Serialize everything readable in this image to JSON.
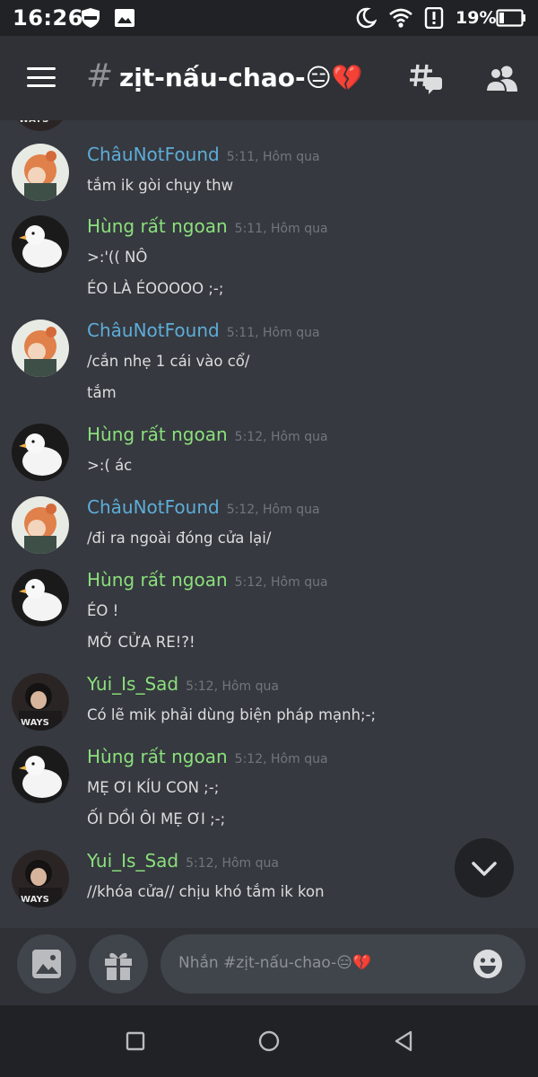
{
  "status_bar": {
    "time": "16:26",
    "battery_percent": "19%",
    "icons": [
      "shield-icon",
      "image-icon",
      "moon-icon",
      "wifi-icon",
      "alert-icon",
      "battery-icon"
    ]
  },
  "header": {
    "hash": "#",
    "channel_name": "zịt-nấu-chao-😑💔",
    "icons": [
      "menu-icon",
      "threads-icon",
      "members-icon"
    ]
  },
  "messages": [
    {
      "author": "ChâuNotFound",
      "time": "5:11, Hôm qua",
      "color": "#5dadd9",
      "avatar": "chau",
      "lines": [
        "tắm ik gòi chụy thw"
      ]
    },
    {
      "author": "Hùng rất ngoan",
      "time": "5:11, Hôm qua",
      "color": "#8be07c",
      "avatar": "duck",
      "lines": [
        ">:'(( NÔ",
        "ÉO LÀ ÉOOOOO ;-;"
      ]
    },
    {
      "author": "ChâuNotFound",
      "time": "5:11, Hôm qua",
      "color": "#5dadd9",
      "avatar": "chau",
      "lines": [
        "/cắn nhẹ 1 cái vào cổ/",
        "tắm"
      ]
    },
    {
      "author": "Hùng rất ngoan",
      "time": "5:12, Hôm qua",
      "color": "#8be07c",
      "avatar": "duck",
      "lines": [
        ">:( ác"
      ]
    },
    {
      "author": "ChâuNotFound",
      "time": "5:12, Hôm qua",
      "color": "#5dadd9",
      "avatar": "chau",
      "lines": [
        "/đi ra ngoài đóng cửa lại/"
      ]
    },
    {
      "author": "Hùng rất ngoan",
      "time": "5:12, Hôm qua",
      "color": "#8be07c",
      "avatar": "duck",
      "lines": [
        "ÉO !",
        "MỞ CỬA RE!?!"
      ]
    },
    {
      "author": "Yui_Is_Sad",
      "time": "5:12, Hôm qua",
      "color": "#8be07c",
      "avatar": "yui",
      "lines": [
        "Có lẽ mik phải dùng biện pháp mạnh;-;"
      ]
    },
    {
      "author": "Hùng rất ngoan",
      "time": "5:12, Hôm qua",
      "color": "#8be07c",
      "avatar": "duck",
      "lines": [
        "MẸ ƠI KÍU CON ;-;",
        "ỐI DỒI ÔI MẸ ƠI ;-;"
      ]
    },
    {
      "author": "Yui_Is_Sad",
      "time": "5:12, Hôm qua",
      "color": "#8be07c",
      "avatar": "yui",
      "lines": [
        "//khóa cửa// chịu khó tắm ik kon"
      ]
    }
  ],
  "composer": {
    "placeholder": "Nhắn #zịt-nấu-chao-😑💔",
    "icons": [
      "image-icon",
      "gift-icon",
      "emoji-icon"
    ]
  },
  "jump_button": {
    "icon": "chevron-down-icon"
  },
  "nav_bar": {
    "icons": [
      "recents-icon",
      "home-icon",
      "back-icon"
    ]
  },
  "colors": {
    "background": "#36393f",
    "header": "#2f3136",
    "bar": "#202225",
    "input": "#40444b"
  }
}
